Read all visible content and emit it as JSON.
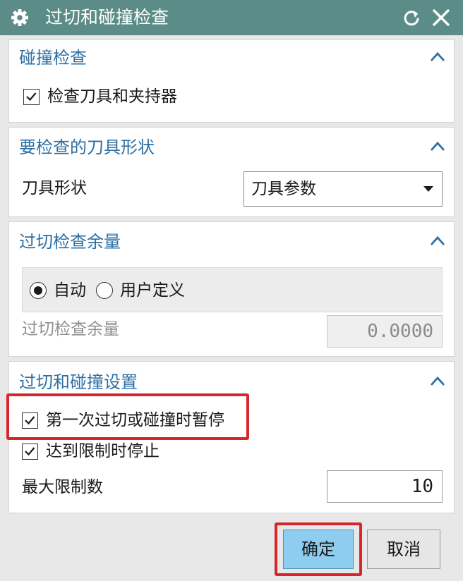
{
  "window": {
    "title": "过切和碰撞检查",
    "icons": {
      "settings": "gear-icon",
      "reset": "reset-icon",
      "close": "close-icon"
    }
  },
  "sections": {
    "collision": {
      "title": "碰撞检查",
      "check_holder_label": "检查刀具和夹持器",
      "check_holder_checked": true
    },
    "tool_shape": {
      "title": "要检查的刀具形状",
      "shape_label": "刀具形状",
      "shape_value": "刀具参数"
    },
    "gouge_stock": {
      "title": "过切检查余量",
      "auto_label": "自动",
      "user_label": "用户定义",
      "selected": "自动",
      "stock_label": "过切检查余量",
      "stock_value": "0.0000"
    },
    "settings": {
      "title": "过切和碰撞设置",
      "pause_label": "第一次过切或碰撞时暂停",
      "pause_checked": true,
      "stop_label": "达到限制时停止",
      "stop_checked": true,
      "max_label": "最大限制数",
      "max_value": "10"
    }
  },
  "buttons": {
    "ok": "确定",
    "cancel": "取消"
  },
  "colors": {
    "titlebar": "#5b8c87",
    "section_title": "#2c6fa3",
    "highlight": "#d6262b",
    "primary_button": "#8fcdf0"
  }
}
